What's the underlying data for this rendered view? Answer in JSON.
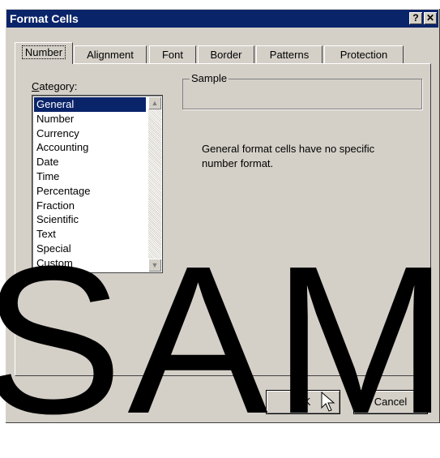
{
  "window": {
    "title": "Format Cells",
    "help_label": "?",
    "close_label": "✕"
  },
  "tabs": [
    {
      "label": "Number"
    },
    {
      "label": "Alignment"
    },
    {
      "label": "Font"
    },
    {
      "label": "Border"
    },
    {
      "label": "Patterns"
    },
    {
      "label": "Protection"
    }
  ],
  "category": {
    "label_first": "C",
    "label_rest": "ategory:",
    "items": [
      "General",
      "Number",
      "Currency",
      "Accounting",
      "Date",
      "Time",
      "Percentage",
      "Fraction",
      "Scientific",
      "Text",
      "Special",
      "Custom"
    ],
    "selected": "General"
  },
  "sample": {
    "legend": "Sample",
    "value": ""
  },
  "description": "General format cells have no specific number format.",
  "buttons": {
    "ok": "OK",
    "cancel": "Cancel"
  },
  "watermark": "SAM",
  "icons": {
    "scroll_up": "scroll-up-icon",
    "scroll_down": "scroll-down-icon",
    "cursor": "mouse-pointer-icon"
  }
}
